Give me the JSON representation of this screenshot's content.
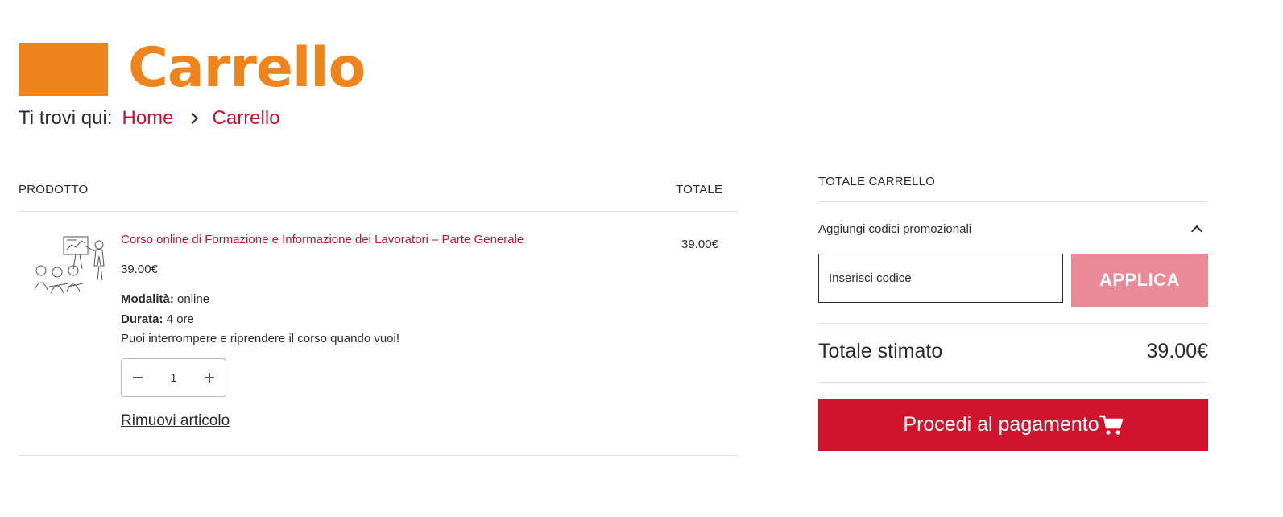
{
  "header": {
    "title": "Carrello",
    "brand_color": "#f0841c"
  },
  "breadcrumb": {
    "prefix": "Ti trovi qui:",
    "items": [
      "Home",
      "Carrello"
    ]
  },
  "cart": {
    "columns": {
      "product": "PRODOTTO",
      "total": "TOTALE"
    },
    "items": [
      {
        "name": "Corso online di Formazione e Informazione dei Lavoratori – Parte Generale",
        "price": "39.00€",
        "mode_label": "Modalità:",
        "mode_value": "online",
        "duration_label": "Durata:",
        "duration_value": "4 ore",
        "note": "Puoi interrompere e riprendere il corso quando vuoi!",
        "quantity": "1",
        "line_total": "39.00€",
        "remove_label": "Rimuovi articolo",
        "thumbnail_icon": "classroom-illustration"
      }
    ]
  },
  "totals": {
    "title": "TOTALE CARRELLO",
    "promo_toggle_label": "Aggiungi codici promozionali",
    "coupon_placeholder": "Inserisci codice",
    "apply_label": "APPLICA",
    "estimated_label": "Totale stimato",
    "estimated_value": "39.00€",
    "checkout_label": "Procedi al pagamento",
    "checkout_icon": "shopping-cart-icon"
  },
  "colors": {
    "accent_red": "#d1142d",
    "link_red": "#c8102e",
    "apply_disabled": "#e98a96"
  }
}
